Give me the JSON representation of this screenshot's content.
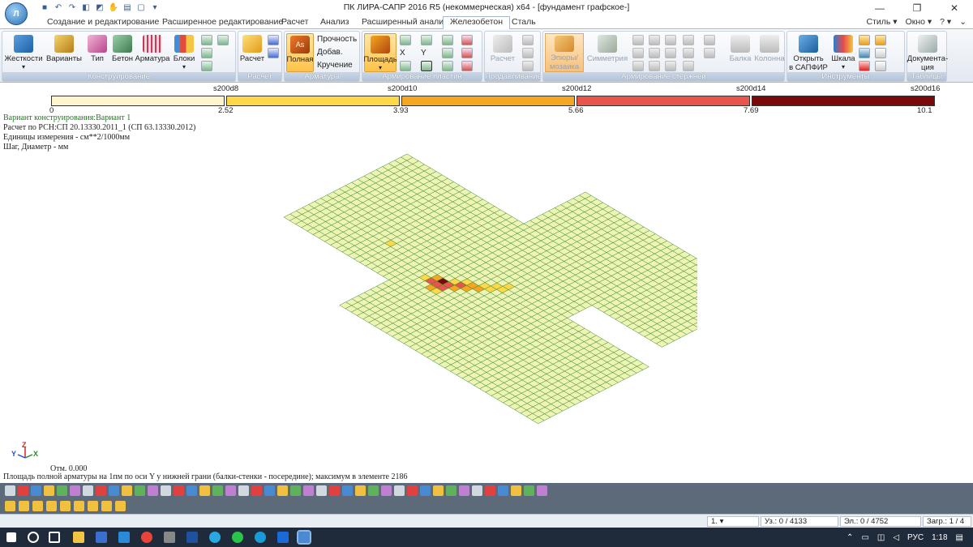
{
  "window": {
    "title": "ПК ЛИРА-САПР  2016 R5 (некоммерческая) x64 - [фундамент графское-]",
    "controls": [
      "—",
      "❐",
      "✕"
    ]
  },
  "tabs": [
    {
      "label": "Создание и редактирование",
      "active": false
    },
    {
      "label": "Расширенное редактирование",
      "active": false
    },
    {
      "label": "Расчет",
      "active": false
    },
    {
      "label": "Анализ",
      "active": false
    },
    {
      "label": "Расширенный анализ",
      "active": false
    },
    {
      "label": "Железобетон",
      "active": true
    },
    {
      "label": "Сталь",
      "active": false
    }
  ],
  "tabs_right": [
    "Стиль ▾",
    "Окно ▾",
    "? ▾",
    "⌄"
  ],
  "ribbon": {
    "groups": {
      "design": "Конструирование",
      "calc": "Расчет",
      "reinf": "Арматура",
      "plates": "Армирование пластин",
      "punch": "Продавливание",
      "bars": "Армирование стержней",
      "tools": "Инструменты",
      "tables": "Таблицы"
    },
    "buttons": {
      "stiffness": "Жесткости",
      "variants": "Варианты",
      "type": "Тип",
      "concrete": "Бетон",
      "rebar": "Арматура",
      "blocks": "Блоки",
      "calc": "Расчет",
      "full": "Полная",
      "strength": "Прочность",
      "added": "Добав.",
      "torsion": "Кручение",
      "area": "Площадь",
      "x": "X",
      "y": "Y",
      "punch_calc": "Расчет",
      "diagrams_line1": "Эпюры/",
      "diagrams_line2": "мозаика",
      "symmetry": "Симметрия",
      "beam": "Балка",
      "column": "Колонна",
      "open_line1": "Открыть",
      "open_line2": "в САПФИР",
      "scale": "Шкала",
      "docs_line1": "Документа-",
      "docs_line2": "ция"
    }
  },
  "scale": {
    "labels": [
      "s200d8",
      "s200d10",
      "s200d12",
      "s200d14",
      "s200d16"
    ],
    "ticks": [
      "0",
      "2.52",
      "3.93",
      "5.66",
      "7.69",
      "10.1"
    ],
    "colors": [
      "#fff5cc",
      "#ffd84a",
      "#f5a623",
      "#e8554a",
      "#7a0a0a"
    ]
  },
  "info": {
    "line1": "Вариант конструирования:Вариант 1",
    "line2": "Расчет по РСН:СП 20.13330.2011_1 (СП 63.13330.2012)",
    "line3": "Единицы измерения - см**2/1000мм",
    "line4": "Шаг, Диаметр - мм"
  },
  "axes": {
    "y": "Y",
    "z": "Z",
    "x": "X"
  },
  "elevation": "Отм. 0.000",
  "description": "Площадь полной арматуры на 1пм по оси Y у нижней грани (балки-стенки - посередине); максимум в элементе 2186",
  "status": {
    "combo": "1.",
    "nodes": "Уз.: 0 / 4133",
    "elements": "Эл.: 0 / 4752",
    "load": "Загр.: 1 / 4"
  },
  "taskbar": {
    "lang": "РУС",
    "time": "1:18"
  },
  "mesh_colors": {
    "base": "#eef5b4",
    "grid": "#3b8a2e",
    "low": "#ffd84a",
    "mid": "#f5a623",
    "high": "#e8554a",
    "max": "#7a0a0a"
  }
}
